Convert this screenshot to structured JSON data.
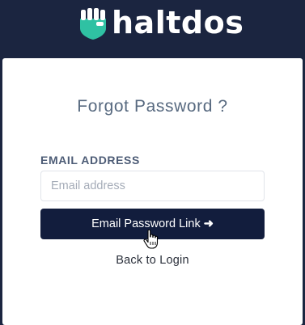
{
  "brand": {
    "name": "haltdos",
    "icon": "haltdos-logo-icon",
    "colors": {
      "mark_green": "#2fc1a3",
      "text": "#ffffff",
      "header_bg": "#1b2540"
    }
  },
  "form": {
    "title": "Forgot Password ?",
    "email_label": "EMAIL ADDRESS",
    "email_placeholder": "Email address",
    "email_value": "",
    "submit_label": "Email Password Link",
    "submit_icon": "arrow-right-icon",
    "submit_color": "#121d3d",
    "back_link": "Back to Login"
  },
  "cursor": {
    "type": "hand-pointer-cursor"
  }
}
